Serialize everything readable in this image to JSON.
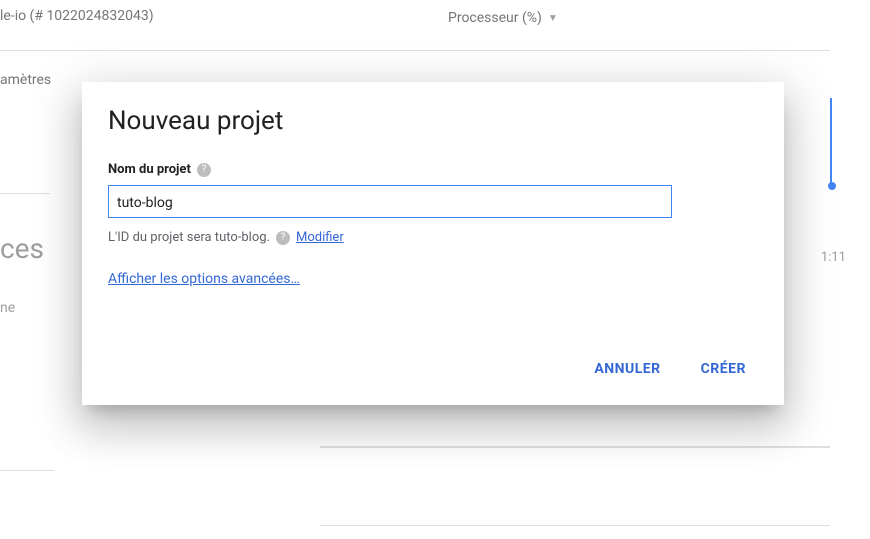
{
  "background": {
    "project_id_fragment": "le-io (# 1022024832043)",
    "processor_label": "Processeur (%)",
    "params_fragment": "amètres",
    "resources_fragment": "ces",
    "ne_fragment": "ne",
    "time_fragment": "1:11"
  },
  "modal": {
    "title": "Nouveau projet",
    "field_label": "Nom du projet",
    "input_value": "tuto-blog",
    "hint_text": "L'ID du projet sera tuto-blog.",
    "modify_link": "Modifier",
    "advanced_link": "Afficher les options avancées…",
    "actions": {
      "cancel": "ANNULER",
      "create": "CRÉER"
    }
  }
}
